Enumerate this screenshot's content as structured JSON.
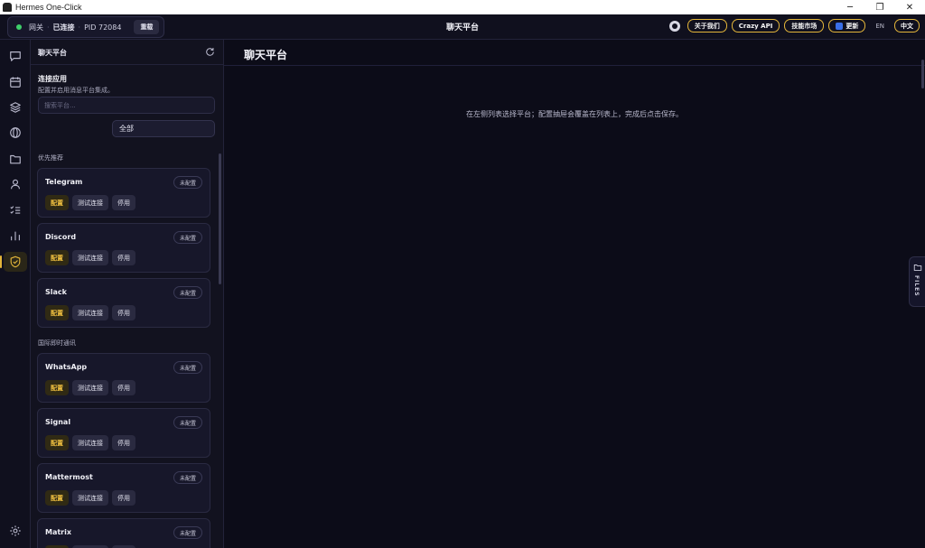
{
  "window": {
    "title": "Hermes One-Click",
    "minimize": "─",
    "restore": "❐",
    "close": "✕"
  },
  "header": {
    "gateway_label": "网关",
    "separator": "·",
    "status": "已连接",
    "pid": "PID 72084",
    "reload_label": "重载",
    "title": "聊天平台",
    "buttons": {
      "about": "关于我们",
      "crazy_api": "Crazy API",
      "skills": "技能市场",
      "update": "更新"
    },
    "lang_en": "EN",
    "lang_zh": "中文"
  },
  "rail": {
    "items": [
      "chat-icon",
      "calendar-icon",
      "layers-icon",
      "globe-icon",
      "folder-icon",
      "user-icon",
      "checklist-icon",
      "chart-icon",
      "shield-icon"
    ],
    "active": "shield-icon",
    "bottom": "settings-icon"
  },
  "panel": {
    "title": "聊天平台",
    "section_title": "连接应用",
    "section_desc": "配置并启用消息平台集成。",
    "search_placeholder": "搜索平台...",
    "filter_label": "全部",
    "groups": {
      "recommended": "优先推荐",
      "international": "国际即时通讯"
    },
    "platforms": [
      {
        "name": "Telegram",
        "status": "未配置"
      },
      {
        "name": "Discord",
        "status": "未配置"
      },
      {
        "name": "Slack",
        "status": "未配置"
      },
      {
        "name": "WhatsApp",
        "status": "未配置"
      },
      {
        "name": "Signal",
        "status": "未配置"
      },
      {
        "name": "Mattermost",
        "status": "未配置"
      },
      {
        "name": "Matrix",
        "status": "未配置"
      }
    ],
    "actions": {
      "configure": "配置",
      "test": "测试连接",
      "disable": "停用"
    }
  },
  "main": {
    "title": "聊天平台",
    "hint": "在左侧列表选择平台；配置抽屉会覆盖在列表上，完成后点击保存。",
    "files_label": "FILES"
  },
  "colors": {
    "accent": "#e3b53a",
    "status_online": "#3ecf6a",
    "background": "#0c0c18"
  }
}
